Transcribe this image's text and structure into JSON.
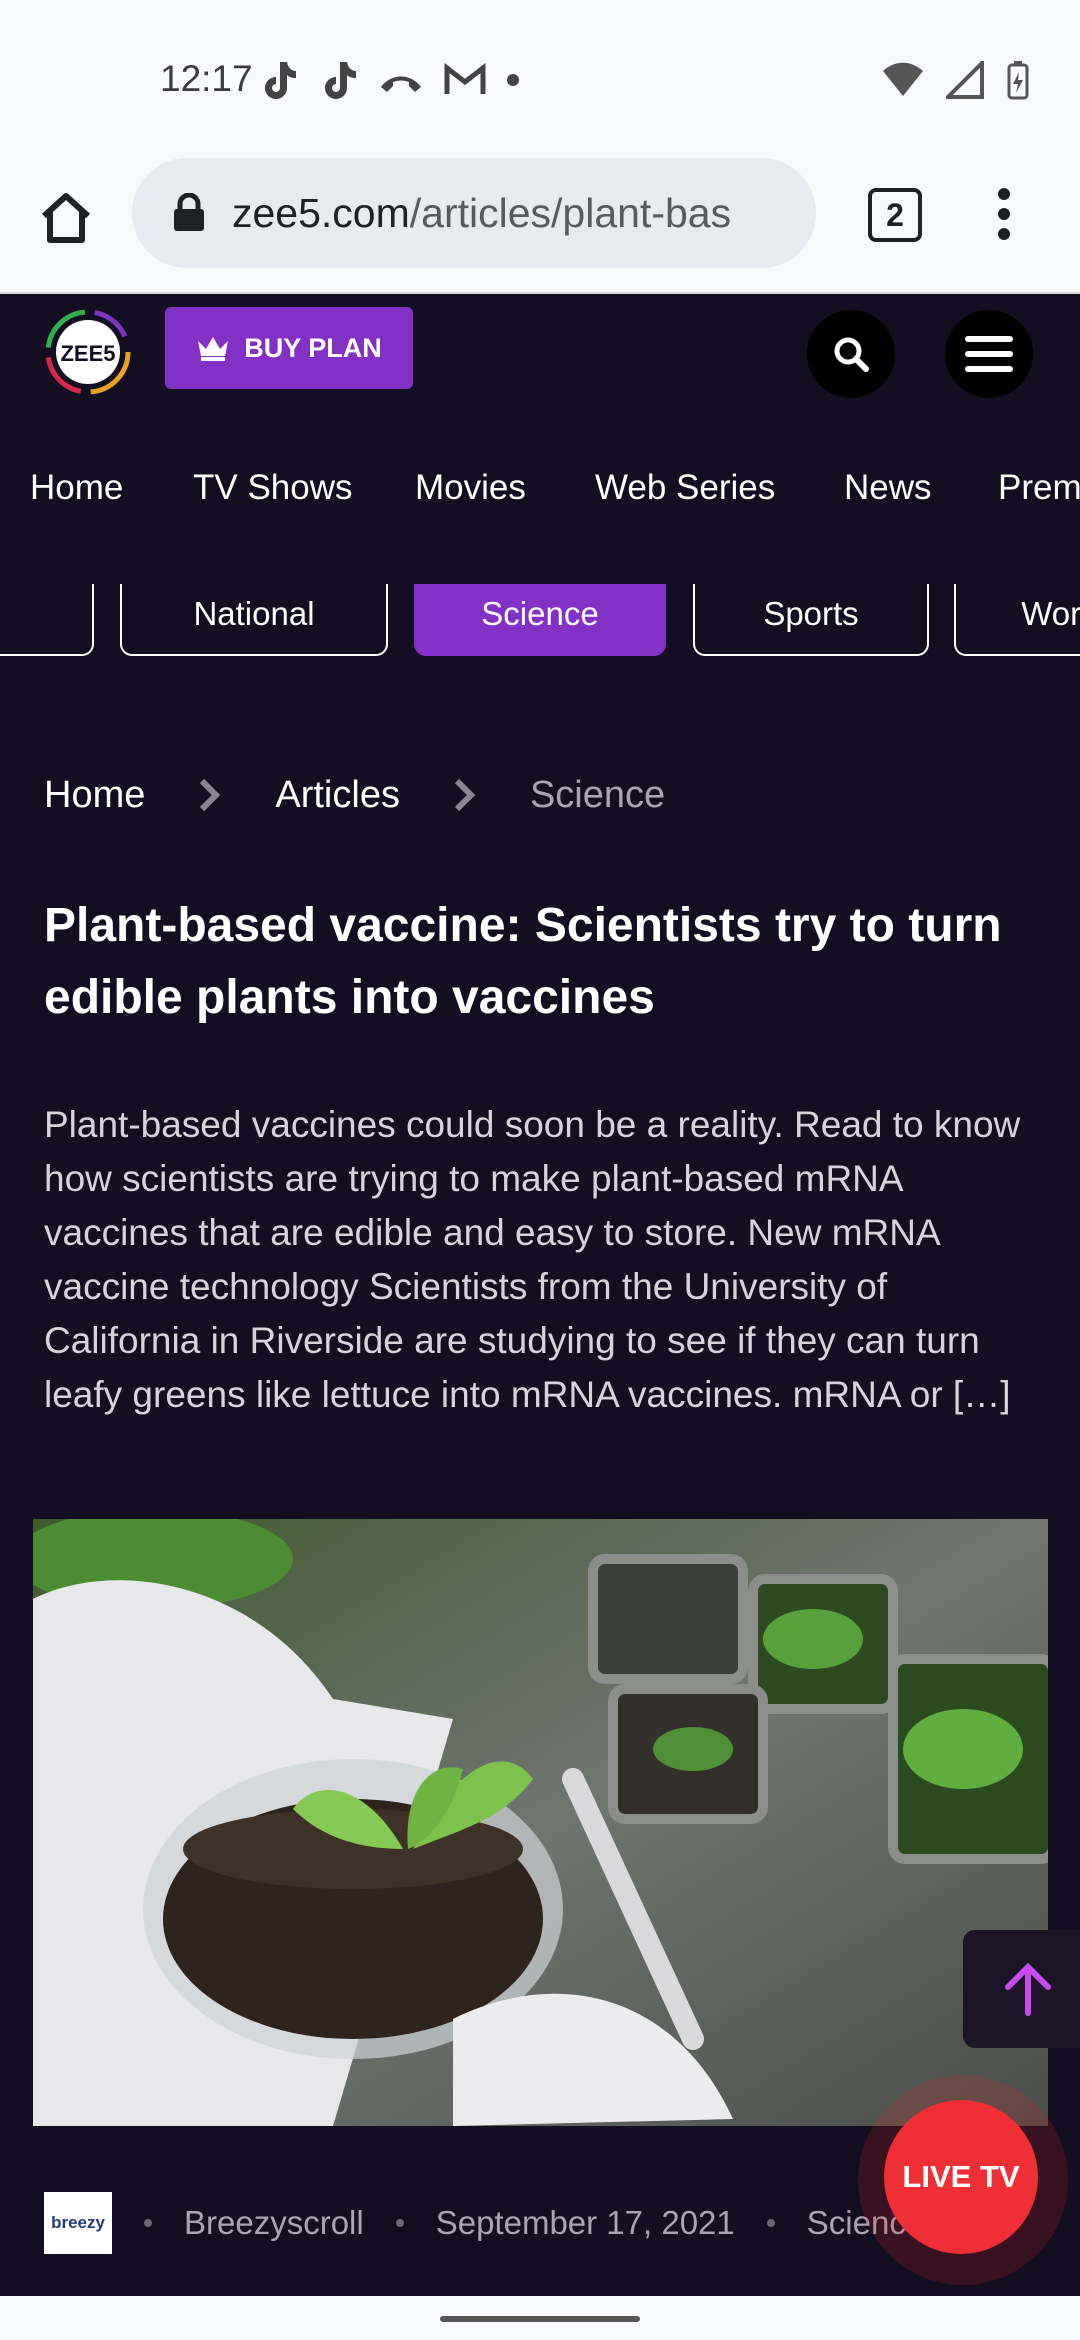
{
  "status_bar": {
    "time": "12:17"
  },
  "browser": {
    "url_domain": "zee5.com",
    "url_path": "/articles/plant-bas",
    "tab_count": "2"
  },
  "header": {
    "buy_plan": "BUY PLAN",
    "logo_text": "ZEE5"
  },
  "nav": [
    "Home",
    "TV Shows",
    "Movies",
    "Web Series",
    "News",
    "Premium"
  ],
  "categories": [
    "",
    "National",
    "Science",
    "Sports",
    "World"
  ],
  "active_category": "Science",
  "breadcrumb": [
    "Home",
    "Articles",
    "Science"
  ],
  "article": {
    "title": "Plant-based vaccine: Scientists try to turn edible plants into vaccines",
    "excerpt": "Plant-based vaccines could soon be a reality. Read to know how scientists are trying to make plant-based mRNA vaccines that are edible and easy to store. New mRNA vaccine technology Scientists from the University of California in Riverside are studying to see if they can turn leafy greens like lettuce into mRNA vaccines. mRNA or […]",
    "author": "Breezyscroll",
    "date": "September 17, 2021",
    "category": "Science",
    "author_logo_text": "breezy"
  },
  "live_tv": "LIVE TV",
  "colors": {
    "background": "#140e22",
    "accent": "#8230c6",
    "live": "#ef2f35"
  }
}
